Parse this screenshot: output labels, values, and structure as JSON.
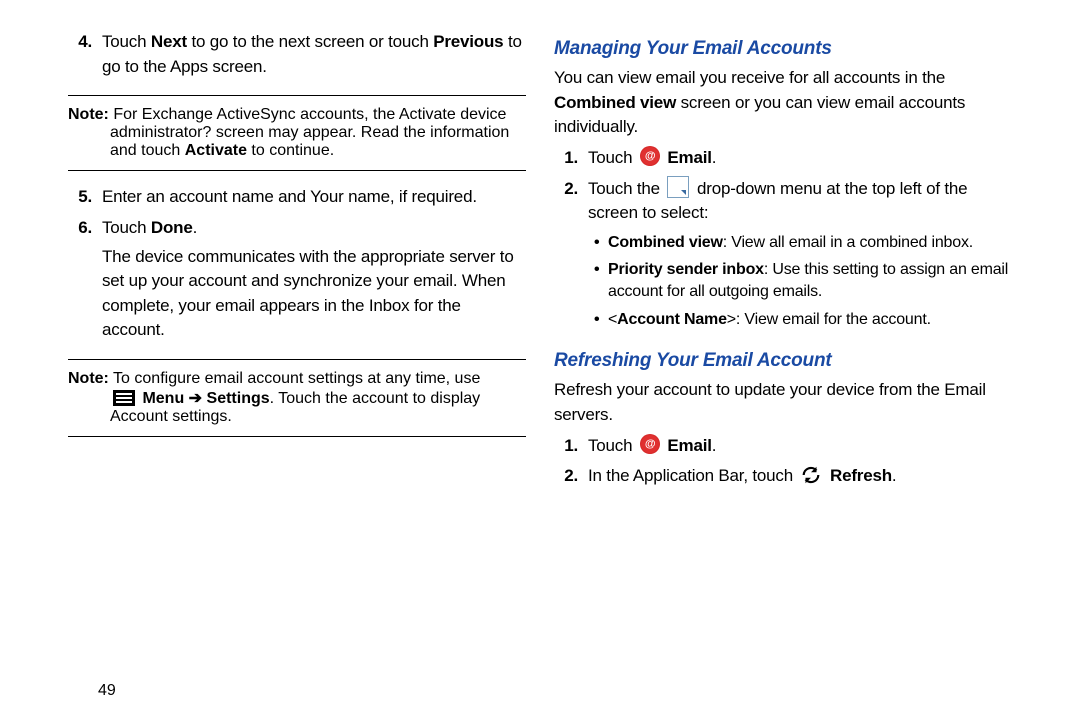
{
  "left": {
    "step4": {
      "num": "4.",
      "pre": "Touch ",
      "next": "Next",
      "mid": " to go to the next screen or touch ",
      "prev": "Previous",
      "post": " to go to the Apps screen."
    },
    "note1": {
      "label": "Note:",
      "text": "For Exchange ActiveSync accounts, the Activate device administrator? screen may appear. Read the information and touch ",
      "activate": "Activate",
      "post": " to continue."
    },
    "step5": {
      "num": "5.",
      "text": "Enter an account name and Your name, if required."
    },
    "step6": {
      "num": "6.",
      "pre": "Touch ",
      "done": "Done",
      "post": ".",
      "body": "The device communicates with the appropriate server to set up your account and synchronize your email. When complete, your email appears in the Inbox for the account."
    },
    "note2": {
      "label": "Note:",
      "pre": "To configure email account settings at any time, use ",
      "menu": "Menu",
      "arrow": " ➔ ",
      "settings": "Settings",
      "post": ". Touch the account to display Account settings."
    },
    "pagenum": "49"
  },
  "right": {
    "h_manage": "Managing Your Email Accounts",
    "manage_intro": {
      "pre": "You can view email you receive for all accounts in the ",
      "cv": "Combined view",
      "post": " screen or you can view email accounts individually."
    },
    "m1": {
      "num": "1.",
      "pre": "Touch ",
      "email": "Email",
      "post": "."
    },
    "m2": {
      "num": "2.",
      "pre": "Touch the ",
      "post": " drop-down menu at the top left of the screen to select:"
    },
    "bullets": {
      "b1": {
        "lbl": "Combined view",
        "txt": ": View all email in a combined inbox."
      },
      "b2": {
        "lbl": "Priority sender inbox",
        "txt": ": Use this setting to assign an email account for all outgoing emails."
      },
      "b3": {
        "pre": "<",
        "lbl": "Account Name",
        "post": ">: View email for the account."
      }
    },
    "h_refresh": "Refreshing Your Email Account",
    "refresh_intro": "Refresh your account to update your device from the Email servers.",
    "r1": {
      "num": "1.",
      "pre": "Touch ",
      "email": "Email",
      "post": "."
    },
    "r2": {
      "num": "2.",
      "pre": "In the Application Bar, touch ",
      "refresh": "Refresh",
      "post": "."
    }
  }
}
